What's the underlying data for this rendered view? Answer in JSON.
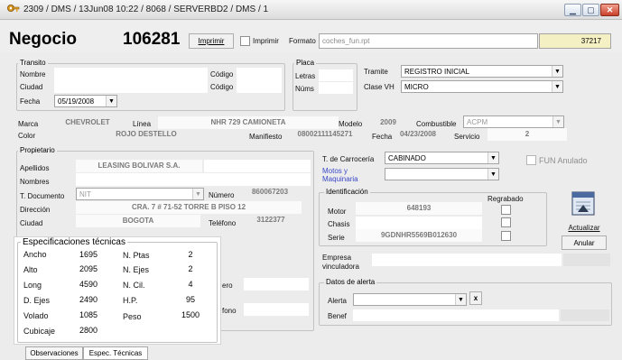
{
  "window": {
    "title": "2309 / DMS   / 13Jun08 10:22 / 8068 / SERVERBD2 / DMS / 1",
    "minimize": "▁",
    "maximize": "▢",
    "close": "✕"
  },
  "header": {
    "title": "Negocio",
    "number": "106281",
    "imprimir_button": "Imprimir",
    "imprimir_checkbox_label": "Imprimir",
    "formato_label": "Formato",
    "formato_value": "coches_fun.rpt",
    "code": "37217"
  },
  "transito": {
    "title": "Transito",
    "nombre_label": "Nombre",
    "codigo1_label": "Código",
    "ciudad_label": "Ciudad",
    "codigo2_label": "Código",
    "fecha_label": "Fecha",
    "fecha_value": "05/19/2008"
  },
  "placa": {
    "title": "Placa",
    "letras_label": "Letras",
    "nums_label": "Núms"
  },
  "tramite": {
    "tramite_label": "Tramite",
    "tramite_value": "REGISTRO INICIAL",
    "clase_label": "Clase VH",
    "clase_value": "MICRO"
  },
  "vehicle": {
    "marca_label": "Marca",
    "marca_value": "CHEVROLET",
    "linea_label": "Línea",
    "linea_value": "NHR 729 CAMIONETA",
    "modelo_label": "Modelo",
    "modelo_value": "2009",
    "combustible_label": "Combustible",
    "combustible_value": "ACPM",
    "color_label": "Color",
    "color_value": "ROJO DESTELLO",
    "manifiesto_label": "Manifiesto",
    "manifiesto_value": "08002111145271",
    "fecha_label": "Fecha",
    "fecha_value": "04/23/2008",
    "servicio_label": "Servicio",
    "servicio_value": "2"
  },
  "propietario": {
    "title": "Propietario",
    "apellidos_label": "Apellidos",
    "apellidos_value": "LEASING BOLIVAR S.A.",
    "nombres_label": "Nombres",
    "tdoc_label": "T. Documento",
    "tdoc_value": "NIT",
    "numero_label": "Número",
    "numero_value": "860067203",
    "direccion_label": "Dirección",
    "direccion_value": "CRA. 7 # 71-52 TORRE B PISO 12",
    "ciudad_label": "Ciudad",
    "ciudad_value": "BOGOTA",
    "telefono_label": "Teléfono",
    "telefono_value": "3122377",
    "hidden_label_1": "ero",
    "hidden_label_2": "fono"
  },
  "carroceria": {
    "tcarroceria_label": "T. de Carrocería",
    "tcarroceria_value": "CABINADO",
    "fun_anulado_label": "FUN Anulado",
    "motos_label": "Motos y Maquinaria"
  },
  "identificacion": {
    "title": "Identificación",
    "regrabado_label": "Regrabado",
    "motor_label": "Motor",
    "motor_value": "648193",
    "chasis_label": "Chasis",
    "serie_label": "Serie",
    "serie_value": "9GDNHR5569B012630"
  },
  "actions": {
    "actualizar": "Actualizar",
    "anular": "Anular"
  },
  "empresa": {
    "label": "Empresa vinculadora"
  },
  "alerta": {
    "title": "Datos de alerta",
    "alerta_label": "Alerta",
    "clear_button": "x",
    "benef_label": "Benef"
  },
  "specs": {
    "title": "Especificaciones técnicas",
    "rows": [
      {
        "l1": "Ancho",
        "v1": "1695",
        "l2": "N. Ptas",
        "v2": "2"
      },
      {
        "l1": "Alto",
        "v1": "2095",
        "l2": "N. Ejes",
        "v2": "2"
      },
      {
        "l1": "Long",
        "v1": "4590",
        "l2": "N. Cil.",
        "v2": "4"
      },
      {
        "l1": "D. Ejes",
        "v1": "2490",
        "l2": "H.P.",
        "v2": "95"
      },
      {
        "l1": "Volado",
        "v1": "1085",
        "l2": "Peso",
        "v2": "1500"
      },
      {
        "l1": "Cubicaje",
        "v1": "2800",
        "l2": "",
        "v2": ""
      }
    ]
  },
  "tabs": {
    "observaciones": "Observaciones",
    "espec": "Espec. Técnicas"
  },
  "icons": {
    "app": "key-icon",
    "calendar": "calendar-icon",
    "dropdown": "▼"
  }
}
